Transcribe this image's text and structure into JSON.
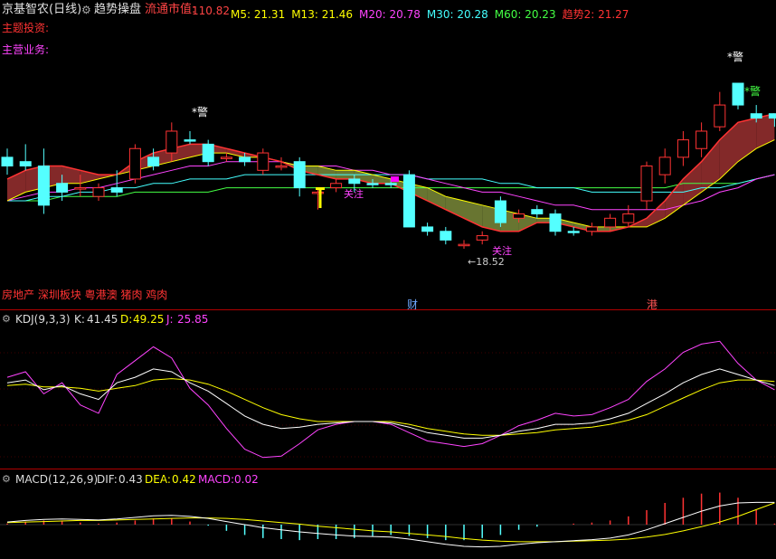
{
  "header": {
    "stock_name": "京基智农(日线)",
    "indicator_name": "趋势操盘",
    "market_value_label": "流通市值:",
    "market_value": "110.82",
    "ma_items": [
      {
        "label": "M5:",
        "value": "21.31",
        "color": "#ffff00"
      },
      {
        "label": "M13:",
        "value": "21.46",
        "color": "#ffff00"
      },
      {
        "label": "M20:",
        "value": "20.78",
        "color": "#ff44ff"
      },
      {
        "label": "M30:",
        "value": "20.28",
        "color": "#44ffff"
      },
      {
        "label": "M60:",
        "value": "20.23",
        "color": "#44ff44"
      },
      {
        "label": "趋势2:",
        "value": "21.27",
        "color": "#ff3333"
      }
    ],
    "topic_label": "主题投资:",
    "business_label": "主营业务:"
  },
  "main_chart": {
    "sector_tags": "房地产 深圳板块 粤港澳 猪肉 鸡肉",
    "annotations": {
      "warn1": "*警",
      "warn2": "*警",
      "warn3": "*警",
      "focus1": "关注",
      "focus2": "关注",
      "low_price": "←18.52"
    },
    "axis_marks": {
      "cai": "财",
      "gang": "港"
    }
  },
  "kdj": {
    "title": "KDJ(9,3,3)",
    "k_label": "K:",
    "k_value": "41.45",
    "d_label": "D:",
    "d_value": "49.25",
    "j_label": "J:",
    "j_value": "25.85"
  },
  "macd": {
    "title": "MACD(12,26,9)",
    "dif_label": "DIF:",
    "dif_value": "0.43",
    "dea_label": "DEA:",
    "dea_value": "0.42",
    "macd_label": "MACD:",
    "macd_value": "0.02"
  },
  "chart_data": {
    "type": "candlestick",
    "low_marker": 18.52,
    "candles": [
      {
        "o": 20.4,
        "h": 20.8,
        "l": 20.2,
        "c": 20.6,
        "up": false
      },
      {
        "o": 20.5,
        "h": 20.9,
        "l": 20.3,
        "c": 20.4,
        "up": false
      },
      {
        "o": 19.5,
        "h": 20.8,
        "l": 19.3,
        "c": 20.4,
        "up": false
      },
      {
        "o": 20.0,
        "h": 20.2,
        "l": 19.6,
        "c": 19.8,
        "up": false
      },
      {
        "o": 19.9,
        "h": 20.2,
        "l": 19.7,
        "c": 19.9,
        "up": true
      },
      {
        "o": 19.7,
        "h": 20.0,
        "l": 19.6,
        "c": 19.9,
        "up": true
      },
      {
        "o": 19.8,
        "h": 20.3,
        "l": 19.7,
        "c": 19.9,
        "up": false
      },
      {
        "o": 20.1,
        "h": 20.9,
        "l": 20.0,
        "c": 20.8,
        "up": true
      },
      {
        "o": 20.6,
        "h": 20.8,
        "l": 20.3,
        "c": 20.4,
        "up": false
      },
      {
        "o": 20.7,
        "h": 21.4,
        "l": 20.5,
        "c": 21.2,
        "up": true
      },
      {
        "o": 21.0,
        "h": 21.2,
        "l": 20.9,
        "c": 21.0,
        "up": false
      },
      {
        "o": 20.9,
        "h": 21.0,
        "l": 20.4,
        "c": 20.5,
        "up": false
      },
      {
        "o": 20.6,
        "h": 20.7,
        "l": 20.5,
        "c": 20.6,
        "up": true
      },
      {
        "o": 20.6,
        "h": 20.7,
        "l": 20.4,
        "c": 20.5,
        "up": false
      },
      {
        "o": 20.3,
        "h": 20.8,
        "l": 20.2,
        "c": 20.7,
        "up": true
      },
      {
        "o": 20.4,
        "h": 20.6,
        "l": 20.3,
        "c": 20.4,
        "up": true
      },
      {
        "o": 20.5,
        "h": 20.6,
        "l": 19.7,
        "c": 19.9,
        "up": false
      },
      {
        "o": 19.8,
        "h": 19.9,
        "l": 19.4,
        "c": 19.8,
        "up": true
      },
      {
        "o": 19.9,
        "h": 20.1,
        "l": 19.8,
        "c": 20.0,
        "up": true
      },
      {
        "o": 20.1,
        "h": 20.2,
        "l": 19.8,
        "c": 20.0,
        "up": false
      },
      {
        "o": 20.0,
        "h": 20.1,
        "l": 19.9,
        "c": 20.0,
        "up": false
      },
      {
        "o": 20.0,
        "h": 20.1,
        "l": 19.9,
        "c": 20.0,
        "up": false
      },
      {
        "o": 20.2,
        "h": 20.3,
        "l": 19.0,
        "c": 19.0,
        "up": false
      },
      {
        "o": 19.0,
        "h": 19.1,
        "l": 18.8,
        "c": 18.9,
        "up": false
      },
      {
        "o": 18.9,
        "h": 19.0,
        "l": 18.6,
        "c": 18.7,
        "up": false
      },
      {
        "o": 18.6,
        "h": 18.7,
        "l": 18.5,
        "c": 18.6,
        "up": true
      },
      {
        "o": 18.7,
        "h": 18.9,
        "l": 18.6,
        "c": 18.8,
        "up": true
      },
      {
        "o": 19.6,
        "h": 19.7,
        "l": 19.0,
        "c": 19.1,
        "up": false
      },
      {
        "o": 19.2,
        "h": 19.4,
        "l": 19.1,
        "c": 19.3,
        "up": true
      },
      {
        "o": 19.4,
        "h": 19.5,
        "l": 19.2,
        "c": 19.3,
        "up": false
      },
      {
        "o": 19.3,
        "h": 19.4,
        "l": 18.8,
        "c": 18.9,
        "up": false
      },
      {
        "o": 18.9,
        "h": 19.0,
        "l": 18.8,
        "c": 18.9,
        "up": false
      },
      {
        "o": 18.9,
        "h": 19.1,
        "l": 18.8,
        "c": 19.0,
        "up": true
      },
      {
        "o": 19.0,
        "h": 19.3,
        "l": 18.9,
        "c": 19.2,
        "up": true
      },
      {
        "o": 19.1,
        "h": 19.5,
        "l": 19.0,
        "c": 19.3,
        "up": true
      },
      {
        "o": 19.6,
        "h": 20.5,
        "l": 19.4,
        "c": 20.4,
        "up": true
      },
      {
        "o": 20.2,
        "h": 20.8,
        "l": 20.0,
        "c": 20.6,
        "up": true
      },
      {
        "o": 20.6,
        "h": 21.2,
        "l": 20.4,
        "c": 21.0,
        "up": true
      },
      {
        "o": 20.8,
        "h": 21.4,
        "l": 20.6,
        "c": 21.2,
        "up": true
      },
      {
        "o": 21.3,
        "h": 22.1,
        "l": 21.2,
        "c": 21.8,
        "up": true
      },
      {
        "o": 22.3,
        "h": 22.3,
        "l": 21.7,
        "c": 21.8,
        "up": false
      },
      {
        "o": 21.6,
        "h": 21.8,
        "l": 21.4,
        "c": 21.5,
        "up": false
      },
      {
        "o": 21.5,
        "h": 21.6,
        "l": 21.3,
        "c": 21.6,
        "up": false
      }
    ],
    "ma5": [
      20.1,
      20.3,
      20.4,
      20.4,
      20.3,
      20.2,
      20.2,
      20.5,
      20.7,
      20.8,
      20.9,
      20.9,
      20.8,
      20.7,
      20.6,
      20.5,
      20.3,
      20.2,
      20.1,
      20.1,
      20.0,
      20.0,
      19.8,
      19.6,
      19.4,
      19.2,
      19.0,
      18.9,
      18.9,
      19.1,
      19.1,
      19.0,
      18.9,
      18.9,
      19.0,
      19.2,
      19.6,
      20.1,
      20.5,
      21.0,
      21.4,
      21.5,
      21.6
    ],
    "ma13": [
      19.6,
      19.8,
      19.9,
      20.0,
      20.0,
      20.1,
      20.2,
      20.3,
      20.4,
      20.5,
      20.6,
      20.7,
      20.7,
      20.6,
      20.6,
      20.5,
      20.4,
      20.4,
      20.3,
      20.3,
      20.2,
      20.1,
      20.0,
      19.9,
      19.7,
      19.6,
      19.5,
      19.4,
      19.3,
      19.2,
      19.2,
      19.1,
      19.0,
      19.0,
      19.0,
      19.0,
      19.2,
      19.5,
      19.8,
      20.1,
      20.5,
      20.8,
      21.0
    ],
    "ma20": [
      19.6,
      19.7,
      19.8,
      19.8,
      19.9,
      19.9,
      20.0,
      20.1,
      20.2,
      20.3,
      20.4,
      20.4,
      20.5,
      20.5,
      20.5,
      20.5,
      20.4,
      20.4,
      20.4,
      20.3,
      20.3,
      20.2,
      20.2,
      20.1,
      20.0,
      19.9,
      19.8,
      19.8,
      19.7,
      19.6,
      19.5,
      19.5,
      19.4,
      19.4,
      19.4,
      19.4,
      19.4,
      19.5,
      19.6,
      19.8,
      19.9,
      20.1,
      20.2
    ],
    "ma30": [
      19.6,
      19.6,
      19.7,
      19.7,
      19.8,
      19.8,
      19.9,
      19.9,
      20.0,
      20.0,
      20.1,
      20.1,
      20.1,
      20.2,
      20.2,
      20.2,
      20.2,
      20.2,
      20.2,
      20.2,
      20.2,
      20.2,
      20.2,
      20.1,
      20.1,
      20.1,
      20.1,
      20.0,
      20.0,
      19.9,
      19.9,
      19.9,
      19.8,
      19.8,
      19.8,
      19.8,
      19.8,
      19.8,
      19.9,
      19.9,
      20.0,
      20.1,
      20.2
    ],
    "ma60": [
      19.6,
      19.6,
      19.6,
      19.7,
      19.7,
      19.7,
      19.7,
      19.8,
      19.8,
      19.8,
      19.8,
      19.8,
      19.9,
      19.9,
      19.9,
      19.9,
      19.9,
      19.9,
      19.9,
      19.9,
      19.9,
      19.9,
      19.9,
      19.9,
      19.9,
      19.9,
      19.9,
      19.9,
      19.9,
      19.9,
      19.9,
      19.9,
      19.9,
      19.9,
      19.9,
      19.9,
      19.9,
      20.0,
      20.0,
      20.0,
      20.0,
      20.1,
      20.2
    ],
    "kdj_k": [
      60,
      62,
      55,
      58,
      52,
      48,
      60,
      64,
      70,
      68,
      60,
      54,
      45,
      36,
      30,
      27,
      28,
      30,
      31,
      32,
      32,
      31,
      28,
      24,
      22,
      20,
      20,
      22,
      25,
      27,
      30,
      30,
      31,
      34,
      38,
      45,
      52,
      60,
      66,
      70,
      66,
      62,
      58
    ],
    "kdj_d": [
      58,
      59,
      57,
      57,
      56,
      54,
      56,
      58,
      62,
      63,
      62,
      59,
      54,
      48,
      42,
      37,
      34,
      32,
      32,
      32,
      32,
      32,
      30,
      27,
      25,
      23,
      22,
      22,
      23,
      24,
      26,
      27,
      28,
      30,
      33,
      37,
      43,
      49,
      55,
      60,
      62,
      62,
      61
    ],
    "kdj_j": [
      64,
      68,
      52,
      60,
      44,
      38,
      66,
      76,
      86,
      78,
      56,
      44,
      27,
      12,
      6,
      7,
      16,
      26,
      30,
      32,
      32,
      30,
      24,
      18,
      16,
      14,
      16,
      22,
      29,
      33,
      38,
      36,
      37,
      42,
      48,
      61,
      70,
      82,
      88,
      90,
      74,
      62,
      55
    ],
    "macd_dif": [
      0.05,
      0.08,
      0.1,
      0.11,
      0.1,
      0.09,
      0.11,
      0.14,
      0.17,
      0.18,
      0.16,
      0.12,
      0.06,
      0.0,
      -0.06,
      -0.1,
      -0.14,
      -0.17,
      -0.2,
      -0.22,
      -0.23,
      -0.24,
      -0.28,
      -0.33,
      -0.38,
      -0.42,
      -0.43,
      -0.42,
      -0.38,
      -0.35,
      -0.33,
      -0.31,
      -0.29,
      -0.26,
      -0.2,
      -0.1,
      0.02,
      0.14,
      0.26,
      0.36,
      0.42,
      0.43,
      0.43
    ],
    "macd_dea": [
      0.04,
      0.05,
      0.06,
      0.07,
      0.08,
      0.08,
      0.09,
      0.1,
      0.11,
      0.12,
      0.13,
      0.13,
      0.12,
      0.1,
      0.07,
      0.04,
      0.01,
      -0.03,
      -0.06,
      -0.09,
      -0.12,
      -0.14,
      -0.17,
      -0.2,
      -0.23,
      -0.27,
      -0.3,
      -0.32,
      -0.33,
      -0.33,
      -0.33,
      -0.32,
      -0.31,
      -0.3,
      -0.28,
      -0.24,
      -0.19,
      -0.12,
      -0.04,
      0.05,
      0.16,
      0.29,
      0.42
    ],
    "macd_hist": [
      0.02,
      0.06,
      0.08,
      0.08,
      0.04,
      0.02,
      0.04,
      0.08,
      0.12,
      0.12,
      0.06,
      -0.02,
      -0.12,
      -0.2,
      -0.26,
      -0.28,
      -0.3,
      -0.28,
      -0.28,
      -0.26,
      -0.22,
      -0.2,
      -0.22,
      -0.26,
      -0.3,
      -0.3,
      -0.26,
      -0.2,
      -0.1,
      -0.04,
      0.0,
      0.02,
      0.04,
      0.08,
      0.16,
      0.28,
      0.42,
      0.52,
      0.6,
      0.62,
      0.52,
      0.28,
      0.02
    ]
  }
}
